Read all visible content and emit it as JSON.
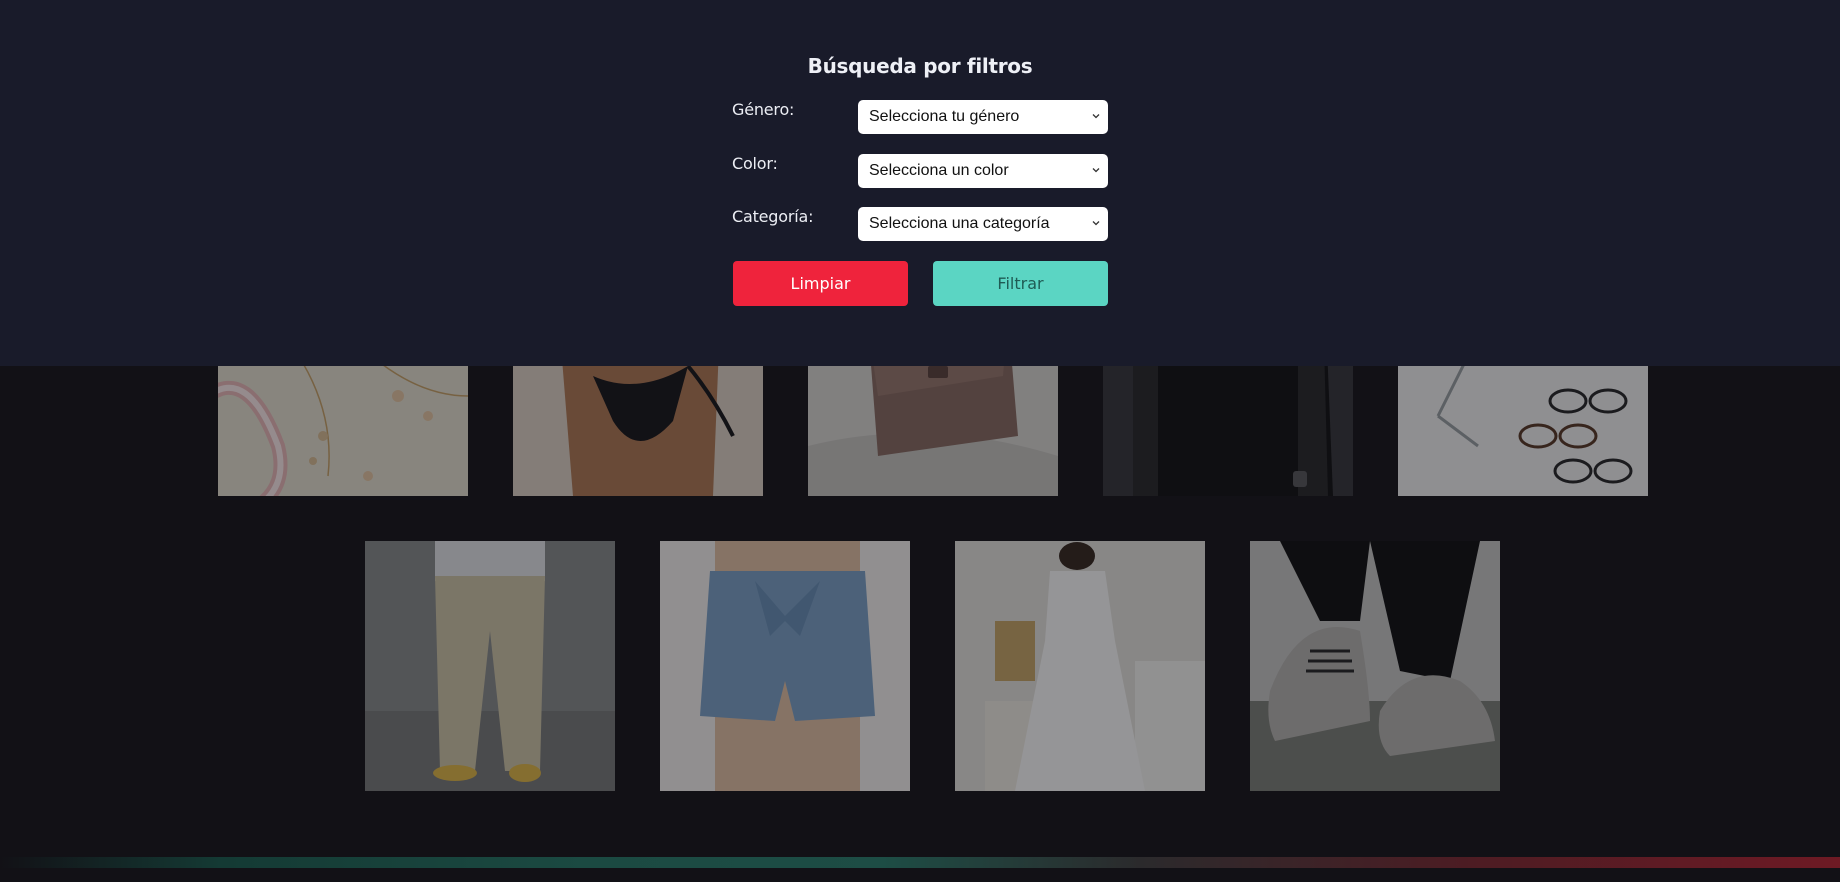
{
  "filters": {
    "title": "Búsqueda por filtros",
    "gender": {
      "label": "Género:",
      "selected": "Selecciona tu género"
    },
    "color": {
      "label": "Color:",
      "selected": "Selecciona un color"
    },
    "category": {
      "label": "Categoría:",
      "selected": "Selecciona una categoría"
    },
    "clear_button": "Limpiar",
    "filter_button": "Filtrar"
  },
  "colors": {
    "panel_background": "#191b2a",
    "page_background": "#121116",
    "clear_button": "#ef233c",
    "filter_button": "#5bd5c3"
  },
  "products": [
    {
      "image": "necklace-photo"
    },
    {
      "image": "bikini-photo"
    },
    {
      "image": "handbag-photo"
    },
    {
      "image": "black-tshirt-photo"
    },
    {
      "image": "eyeglasses-photo"
    },
    {
      "image": "khaki-pants-photo"
    },
    {
      "image": "denim-shorts-photo"
    },
    {
      "image": "white-dress-photo"
    },
    {
      "image": "sneakers-photo"
    }
  ]
}
